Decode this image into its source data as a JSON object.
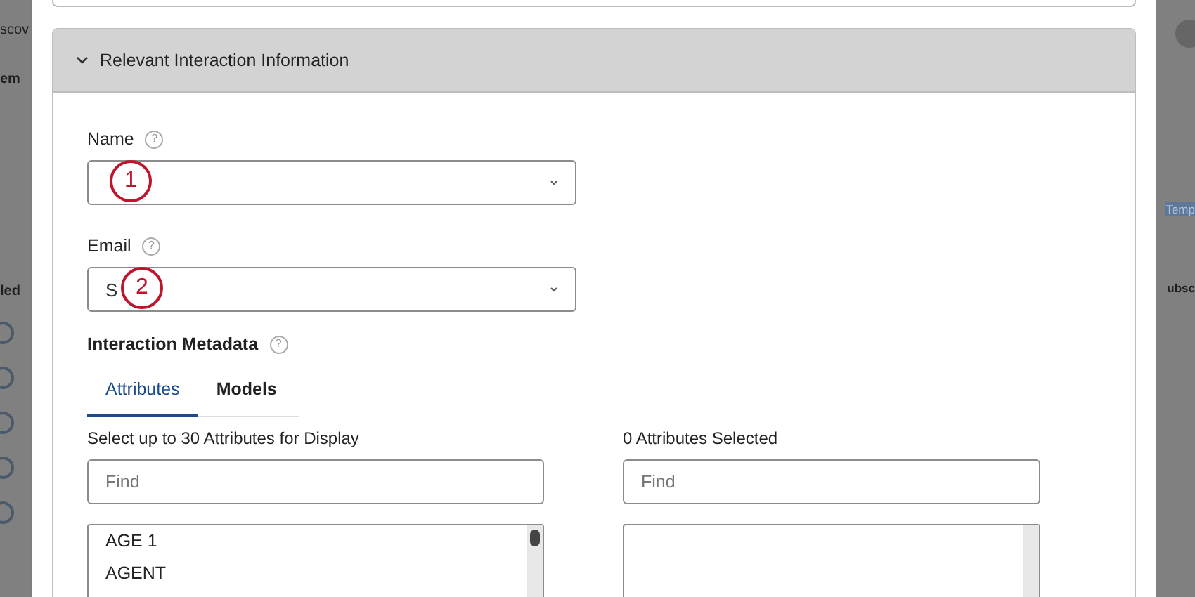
{
  "background_page": {
    "left_texts": [
      "scov",
      "em",
      "led"
    ],
    "right_texts": [
      "Temp",
      "ubsc"
    ],
    "radio_count_rows": [
      {
        "checked": false
      },
      {
        "checked": false
      },
      {
        "checked": false
      },
      {
        "checked": false
      },
      {
        "checked": false
      }
    ]
  },
  "section": {
    "title": "Relevant Interaction Information",
    "expanded": true
  },
  "fields": [
    {
      "label": "Name",
      "help": "?",
      "annotation": "1"
    },
    {
      "label": "Email",
      "help": "?",
      "value": "S",
      "annotation": "2"
    }
  ],
  "metadata": {
    "title": "Interaction Metadata",
    "help": "?",
    "tabs": [
      {
        "label": "Attributes",
        "selected": true
      },
      {
        "label": "Models",
        "selected": false
      }
    ],
    "available": {
      "label": "Select up to 30 Attributes for Display",
      "placeholder": "Find",
      "items": [
        "AGE 1",
        "AGENT"
      ]
    },
    "selected": {
      "label": "0 Attributes Selected",
      "placeholder": "Find"
    }
  }
}
